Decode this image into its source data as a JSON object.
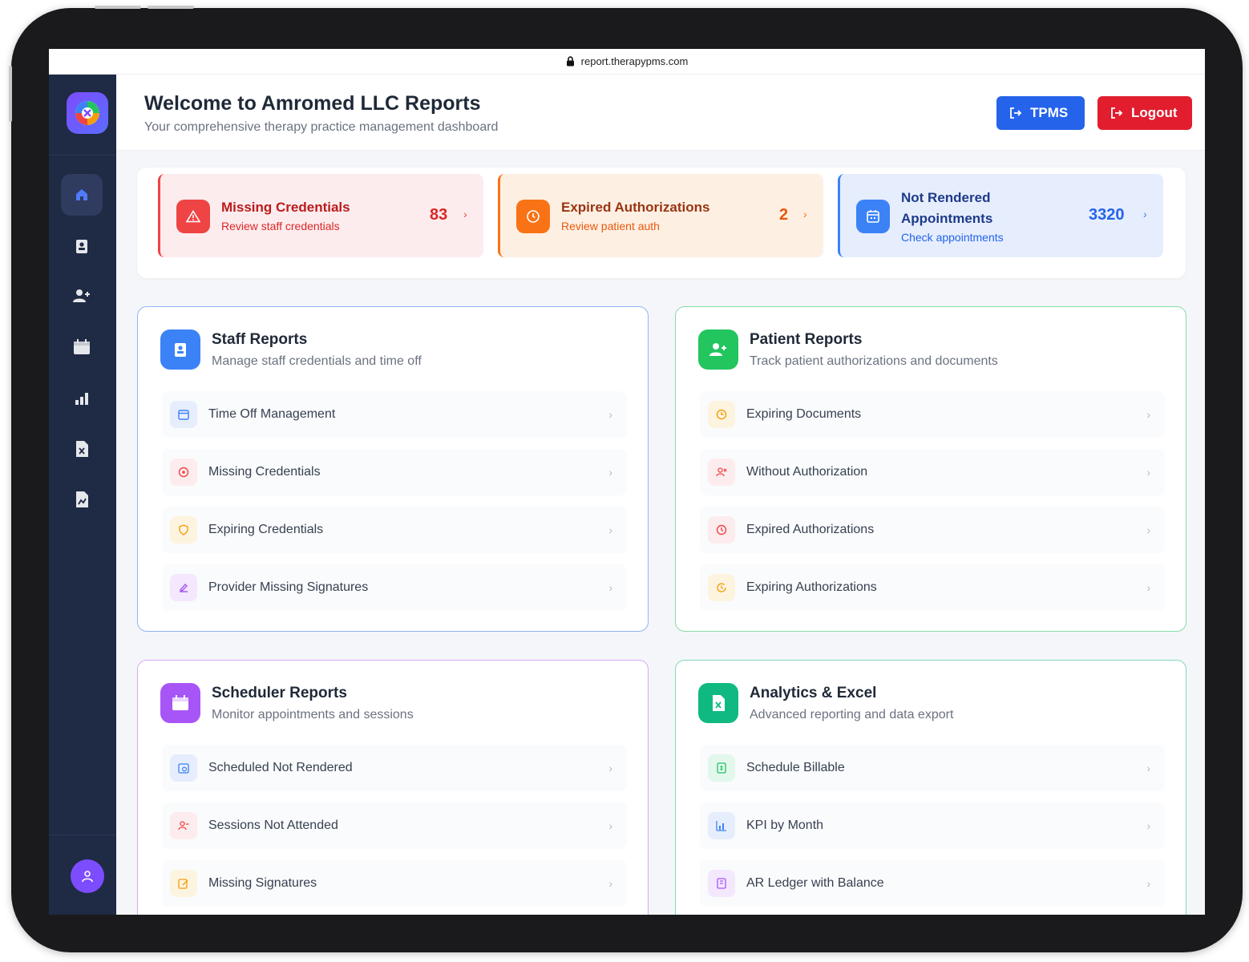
{
  "browser": {
    "url": "report.therapypms.com"
  },
  "header": {
    "title": "Welcome to Amromed LLC Reports",
    "subtitle": "Your comprehensive therapy practice management dashboard",
    "tpms_label": "TPMS",
    "logout_label": "Logout"
  },
  "sidebar": {
    "items": [
      {
        "icon": "home-icon",
        "active": true
      },
      {
        "icon": "staff-badge-icon"
      },
      {
        "icon": "patient-add-icon"
      },
      {
        "icon": "calendar-icon"
      },
      {
        "icon": "bar-chart-icon"
      },
      {
        "icon": "excel-file-icon"
      },
      {
        "icon": "report-file-icon"
      }
    ]
  },
  "alerts": [
    {
      "title": "Missing Credentials",
      "subtitle": "Review staff credentials",
      "count": "83",
      "color": "#e11d2e"
    },
    {
      "title": "Expired Authorizations",
      "subtitle": "Review patient auth",
      "count": "2",
      "color": "#f97316"
    },
    {
      "title": "Not Rendered Appointments",
      "title_line1": "Not Rendered",
      "title_line2": "Appointments",
      "subtitle": "Check appointments",
      "count": "3320",
      "color": "#2563eb"
    }
  ],
  "cards": {
    "staff": {
      "title": "Staff Reports",
      "subtitle": "Manage staff credentials and time off",
      "items": [
        "Time Off Management",
        "Missing Credentials",
        "Expiring Credentials",
        "Provider Missing Signatures"
      ]
    },
    "patient": {
      "title": "Patient Reports",
      "subtitle": "Track patient authorizations and documents",
      "items": [
        "Expiring Documents",
        "Without Authorization",
        "Expired Authorizations",
        "Expiring Authorizations"
      ]
    },
    "scheduler": {
      "title": "Scheduler Reports",
      "subtitle": "Monitor appointments and sessions",
      "items": [
        "Scheduled Not Rendered",
        "Sessions Not Attended",
        "Missing Signatures"
      ]
    },
    "analytics": {
      "title": "Analytics & Excel",
      "subtitle": "Advanced reporting and data export",
      "items": [
        "Schedule Billable",
        "KPI by Month",
        "AR Ledger with Balance"
      ]
    }
  },
  "colors": {
    "staff": "#3b82f6",
    "patient": "#22c55e",
    "scheduler": "#a855f7",
    "analytics": "#10b981"
  }
}
